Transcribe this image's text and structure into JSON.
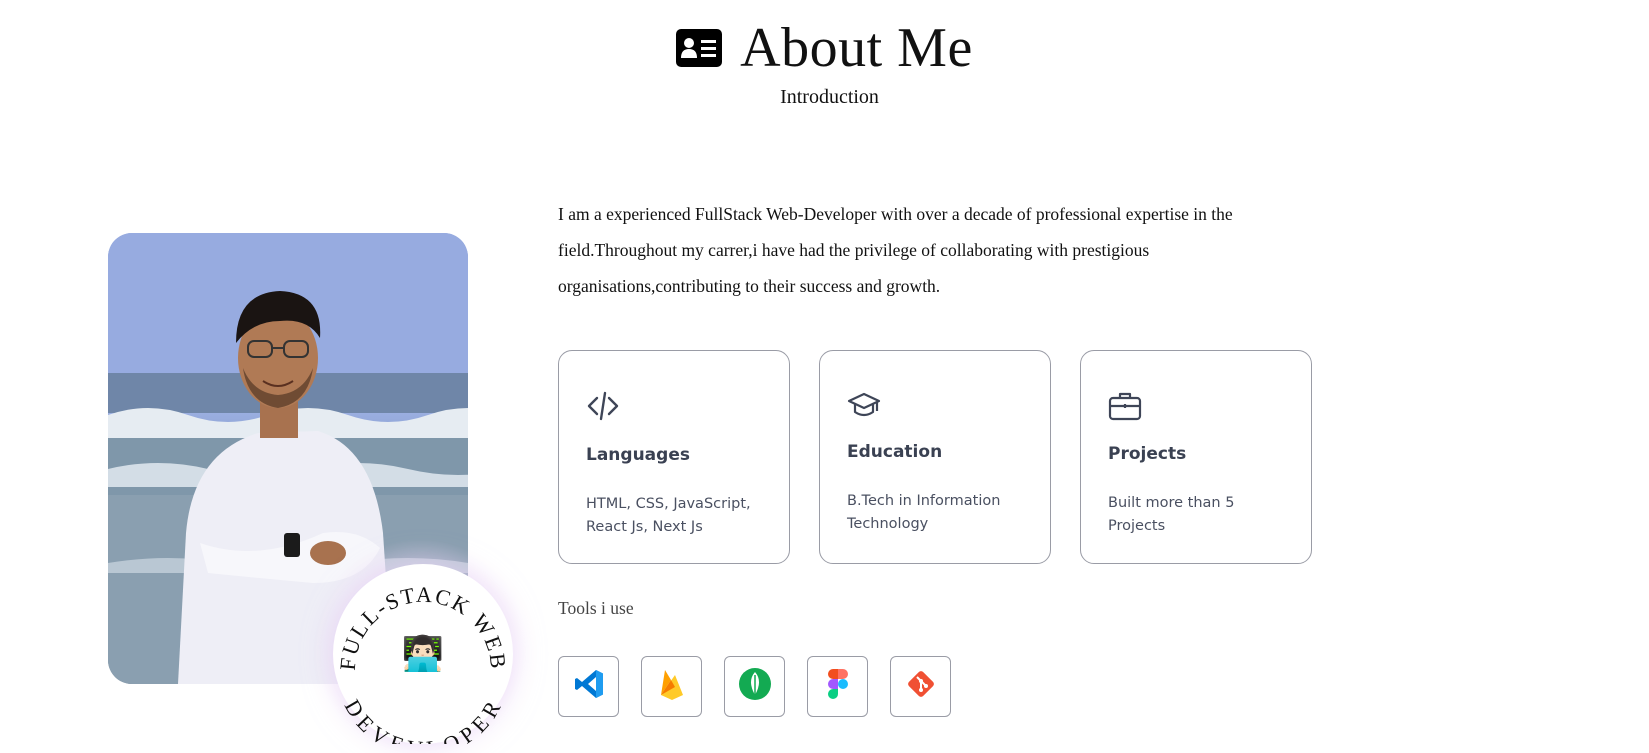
{
  "header": {
    "title": "About Me",
    "subtitle": "Introduction",
    "icon": "id-card-icon"
  },
  "intro": {
    "text": "I am a experienced FullStack Web-Developer with over a decade of professional expertise in the field.Throughout my carrer,i have had the privilege of collaborating with prestigious organisations,contributing to their success and growth."
  },
  "badge": {
    "text_top": "FULL-STACK WEB",
    "text_bottom": "DEVEVLOPER",
    "emoji": "👨🏻‍💻"
  },
  "cards": [
    {
      "icon": "code-icon",
      "title": "Languages",
      "description": "HTML, CSS, JavaScript, React Js, Next Js"
    },
    {
      "icon": "graduation-cap-icon",
      "title": "Education",
      "description": "B.Tech in Information Technology"
    },
    {
      "icon": "briefcase-icon",
      "title": "Projects",
      "description": "Built more than 5 Projects"
    }
  ],
  "tools": {
    "label": "Tools i use",
    "items": [
      {
        "icon": "vscode-icon",
        "color": "#0078d4"
      },
      {
        "icon": "firebase-icon",
        "color": "#ffca28"
      },
      {
        "icon": "mongodb-icon",
        "color": "#13aa52"
      },
      {
        "icon": "figma-icon",
        "color": "#f24e1e"
      },
      {
        "icon": "git-icon",
        "color": "#f05033"
      }
    ]
  },
  "colors": {
    "text": "#111111",
    "card_text": "#3e4557",
    "border": "#9a9ca6"
  }
}
